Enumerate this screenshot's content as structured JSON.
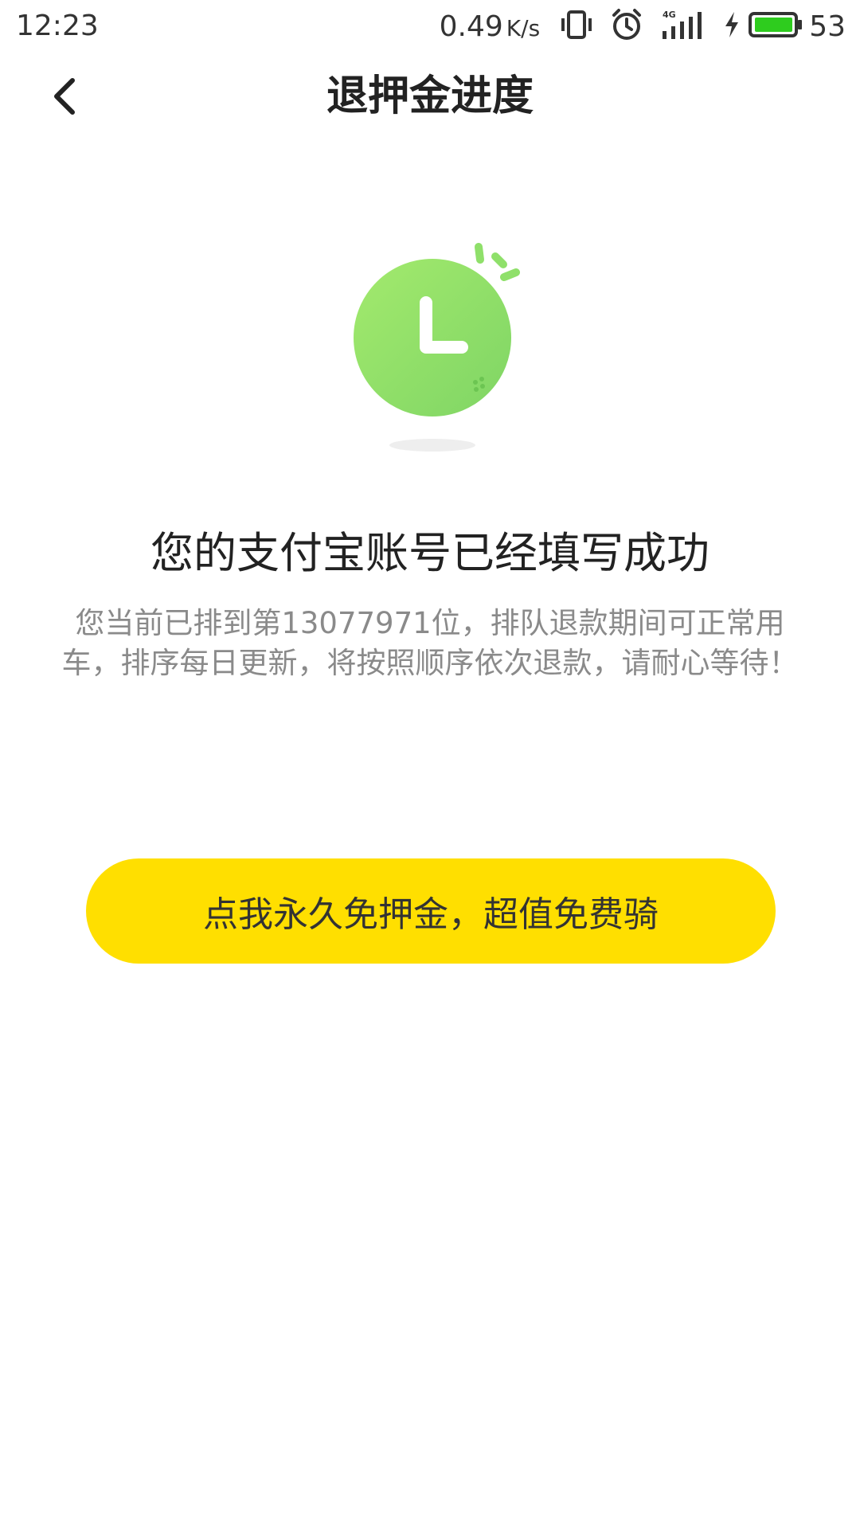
{
  "status_bar": {
    "time": "12:23",
    "net_speed": "0.49",
    "net_speed_unit": "K/s",
    "network_type": "4G",
    "battery_level": "53",
    "icons": [
      "vibrate-icon",
      "alarm-icon",
      "signal-4g-icon",
      "charging-icon",
      "battery-icon"
    ],
    "battery_color": "#2ecc1e"
  },
  "nav": {
    "back_icon": "chevron-left-icon",
    "title": "退押金进度"
  },
  "illustration": {
    "icon": "clock-icon",
    "color": "#8fe06a"
  },
  "main": {
    "headline": "您的支付宝账号已经填写成功",
    "description": "您当前已排到第13077971位，排队退款期间可正常用车，排序每日更新，将按照顺序依次退款，请耐心等待！"
  },
  "cta": {
    "label": "点我永久免押金，超值免费骑",
    "color": "#ffdf00"
  }
}
